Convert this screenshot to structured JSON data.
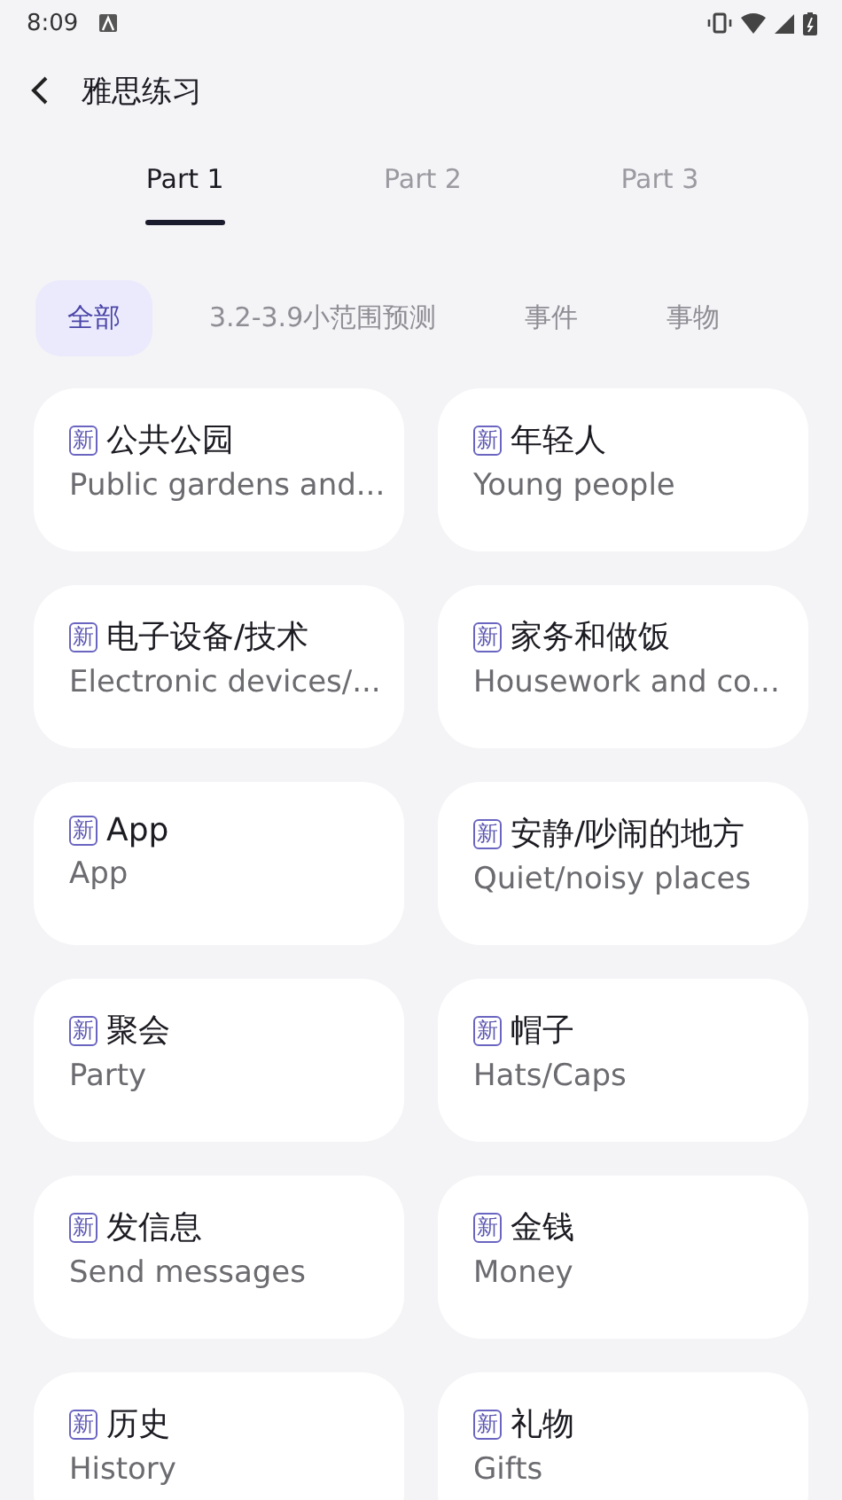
{
  "status_bar": {
    "time": "8:09"
  },
  "header": {
    "title": "雅思练习"
  },
  "tabs": [
    {
      "label": "Part 1",
      "selected": true
    },
    {
      "label": "Part 2",
      "selected": false
    },
    {
      "label": "Part 3",
      "selected": false
    }
  ],
  "chips": [
    {
      "label": "全部",
      "selected": true
    },
    {
      "label": "3.2-3.9小范围预测",
      "selected": false
    },
    {
      "label": "事件",
      "selected": false
    },
    {
      "label": "事物",
      "selected": false
    }
  ],
  "topics": [
    {
      "badge": "新",
      "title": "公共公园",
      "subtitle": "Public gardens and..."
    },
    {
      "badge": "新",
      "title": "年轻人",
      "subtitle": "Young people"
    },
    {
      "badge": "新",
      "title": "电子设备/技术",
      "subtitle": "Electronic devices/..."
    },
    {
      "badge": "新",
      "title": "家务和做饭",
      "subtitle": "Housework and co..."
    },
    {
      "badge": "新",
      "title": "App",
      "subtitle": "App"
    },
    {
      "badge": "新",
      "title": "安静/吵闹的地方",
      "subtitle": "Quiet/noisy places"
    },
    {
      "badge": "新",
      "title": "聚会",
      "subtitle": "Party"
    },
    {
      "badge": "新",
      "title": "帽子",
      "subtitle": "Hats/Caps"
    },
    {
      "badge": "新",
      "title": "发信息",
      "subtitle": "Send messages"
    },
    {
      "badge": "新",
      "title": "金钱",
      "subtitle": "Money"
    },
    {
      "badge": "新",
      "title": "历史",
      "subtitle": "History"
    },
    {
      "badge": "新",
      "title": "礼物",
      "subtitle": "Gifts"
    }
  ]
}
